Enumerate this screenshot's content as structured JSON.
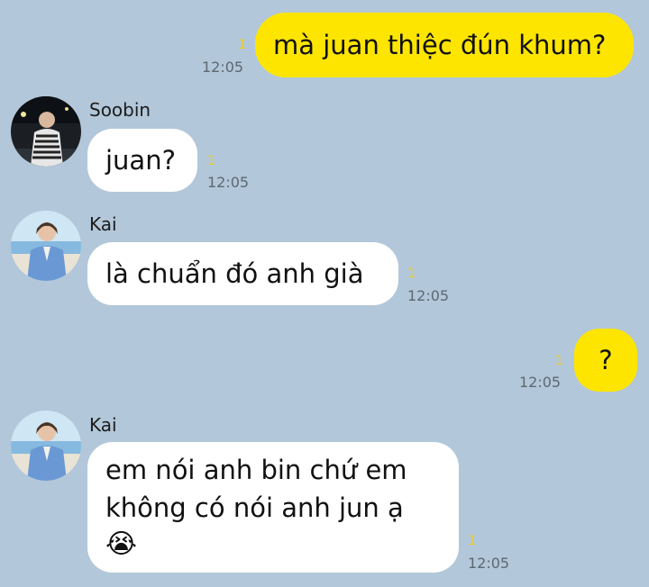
{
  "messages": [
    {
      "sender": "me",
      "text": "mà juan thiệc đún khum?",
      "unread": "1",
      "time": "12:05"
    },
    {
      "sender": "Soobin",
      "text": "juan?",
      "unread": "1",
      "time": "12:05"
    },
    {
      "sender": "Kai",
      "text": "là chuẩn đó anh già",
      "unread": "1",
      "time": "12:05"
    },
    {
      "sender": "me",
      "text": "?",
      "unread": "1",
      "time": "12:05"
    },
    {
      "sender": "Kai",
      "line1": "em nói anh bin chứ em",
      "line2": "không có nói anh jun ạ",
      "emoji": "😭",
      "unread": "1",
      "time": "12:05"
    }
  ],
  "icons": {
    "avatar_soobin": "avatar-photo-night",
    "avatar_kai": "avatar-photo-beach"
  },
  "colors": {
    "background": "#b2c7d9",
    "my_bubble": "#fee500",
    "their_bubble": "#ffffff",
    "unread": "#f2cf15"
  }
}
